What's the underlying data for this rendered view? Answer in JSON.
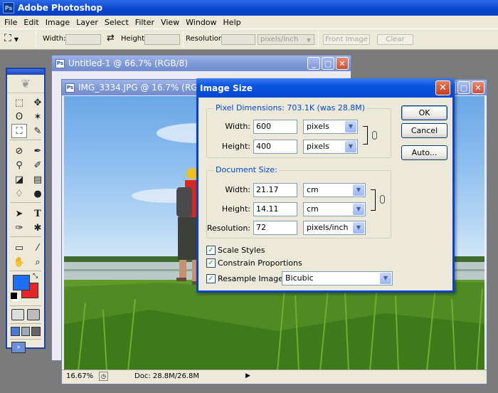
{
  "app": {
    "title": "Adobe Photoshop",
    "icon": "photoshop-icon"
  },
  "menu": [
    "File",
    "Edit",
    "Image",
    "Layer",
    "Select",
    "Filter",
    "View",
    "Window",
    "Help"
  ],
  "options": {
    "width_label": "Width:",
    "height_label": "Height:",
    "resolution_label": "Resolution:",
    "units": "pixels/inch",
    "front_image": "Front Image",
    "clear": "Clear"
  },
  "windows": {
    "back": {
      "title": "Untitled-1 @ 66.7% (RGB/8)"
    },
    "front": {
      "title": "IMG_3334.JPG @ 16.7% (RGB/8)",
      "zoom": "16.67%",
      "doc_info": "Doc: 28.8M/26.8M"
    }
  },
  "dialog": {
    "title": "Image Size",
    "pixel_dimensions": {
      "legend": "Pixel Dimensions:",
      "size": "703.1K (was 28.8M)"
    },
    "pixel_width": {
      "label": "Width:",
      "value": "600",
      "unit": "pixels"
    },
    "pixel_height": {
      "label": "Height:",
      "value": "400",
      "unit": "pixels"
    },
    "document_size": {
      "legend": "Document Size:"
    },
    "doc_width": {
      "label": "Width:",
      "value": "21.17",
      "unit": "cm"
    },
    "doc_height": {
      "label": "Height:",
      "value": "14.11",
      "unit": "cm"
    },
    "resolution": {
      "label": "Resolution:",
      "value": "72",
      "unit": "pixels/inch"
    },
    "scale_styles": {
      "label": "Scale Styles",
      "checked": true
    },
    "constrain": {
      "label": "Constrain Proportions",
      "checked": true
    },
    "resample": {
      "label": "Resample Image:",
      "checked": true,
      "method": "Bicubic"
    },
    "buttons": {
      "ok": "OK",
      "cancel": "Cancel",
      "auto": "Auto..."
    }
  },
  "colors": {
    "foreground": "#1f6ff5",
    "background": "#e8242a",
    "title_active": "#0a55e0",
    "title_inactive": "#7c95d6"
  }
}
